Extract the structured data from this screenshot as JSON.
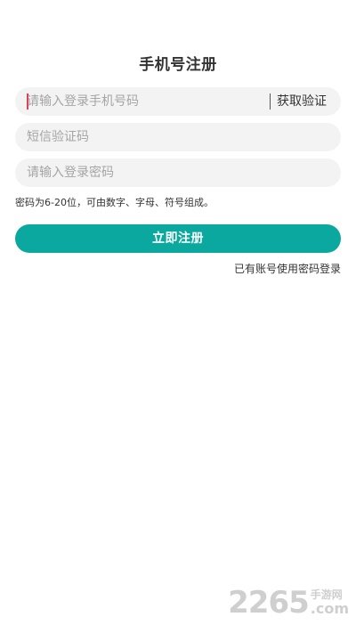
{
  "header": {
    "title": "手机号注册"
  },
  "form": {
    "phone_placeholder": "请输入登录手机号码",
    "get_code_label": "获取验证",
    "sms_placeholder": "短信验证码",
    "password_placeholder": "请输入登录密码",
    "password_hint": "密码为6-20位，可由数字、字母、符号组成。",
    "register_label": "立即注册",
    "login_link_label": "已有账号使用密码登录"
  },
  "watermark": {
    "logo": "2265",
    "site_cn": "手游网",
    "domain": ".com"
  },
  "colors": {
    "accent": "#0aa89e",
    "field_bg": "#f3f3f3",
    "caret": "#d9435a"
  }
}
